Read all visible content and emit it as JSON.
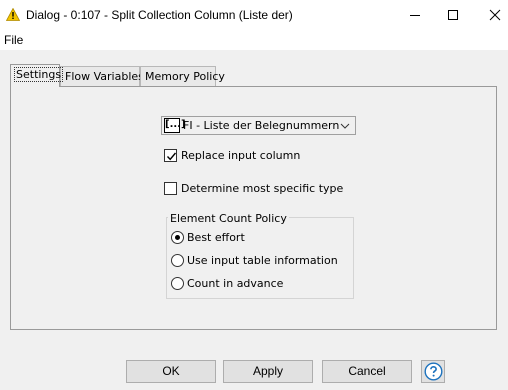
{
  "window": {
    "title": "Dialog - 0:107 - Split Collection Column (Liste der)"
  },
  "menu": {
    "file_label": "File"
  },
  "tabs": [
    {
      "label": "Settings",
      "active": true
    },
    {
      "label": "Flow Variables",
      "active": false
    },
    {
      "label": "Memory Policy",
      "active": false
    }
  ],
  "settings": {
    "column_select": {
      "icon_text": "[...]",
      "value": "FI - Liste der Belegnummern"
    },
    "replace_input_column": {
      "label": "Replace input column",
      "checked": true
    },
    "determine_specific_type": {
      "label": "Determine most specific type",
      "checked": false
    },
    "element_count_policy": {
      "title": "Element Count Policy",
      "options": [
        {
          "label": "Best effort",
          "selected": true
        },
        {
          "label": "Use input table information",
          "selected": false
        },
        {
          "label": "Count in advance",
          "selected": false
        }
      ]
    }
  },
  "buttons": {
    "ok": "OK",
    "apply": "Apply",
    "cancel": "Cancel",
    "help_icon": "question-circle-icon"
  },
  "colors": {
    "warning": "#f2c500",
    "help_blue": "#1e73be",
    "background": "#f0f0f0"
  }
}
